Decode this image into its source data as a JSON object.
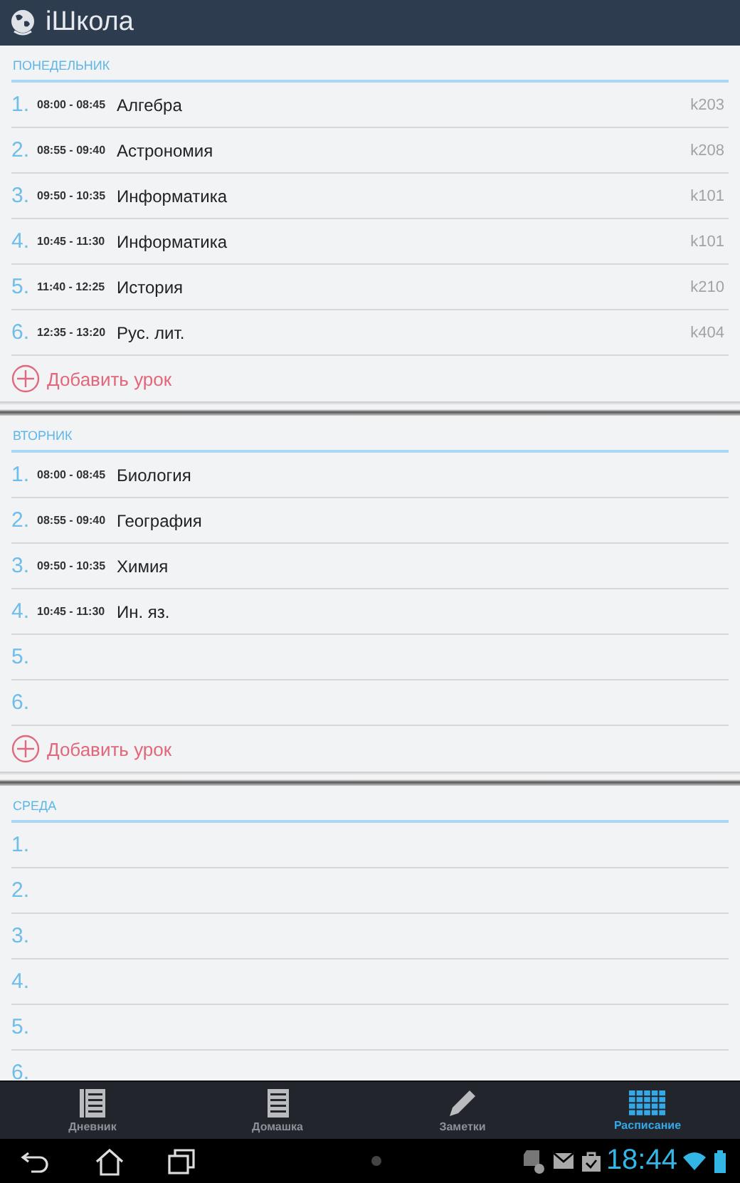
{
  "app_bar": {
    "title": "iШкола"
  },
  "days": [
    {
      "name": "ПОНЕДЕЛЬНИК",
      "lessons": [
        {
          "number": "1.",
          "time": "08:00 - 08:45",
          "subject": "Алгебра",
          "room": "k203"
        },
        {
          "number": "2.",
          "time": "08:55 - 09:40",
          "subject": "Астрономия",
          "room": "k208"
        },
        {
          "number": "3.",
          "time": "09:50 - 10:35",
          "subject": "Информатика",
          "room": "k101"
        },
        {
          "number": "4.",
          "time": "10:45 - 11:30",
          "subject": "Информатика",
          "room": "k101"
        },
        {
          "number": "5.",
          "time": "11:40 - 12:25",
          "subject": "История",
          "room": "k210"
        },
        {
          "number": "6.",
          "time": "12:35 - 13:20",
          "subject": "Рус. лит.",
          "room": "k404"
        }
      ],
      "add_label": "Добавить урок"
    },
    {
      "name": "ВТОРНИК",
      "lessons": [
        {
          "number": "1.",
          "time": "08:00 - 08:45",
          "subject": "Биология"
        },
        {
          "number": "2.",
          "time": "08:55 - 09:40",
          "subject": "География"
        },
        {
          "number": "3.",
          "time": "09:50 - 10:35",
          "subject": "Химия"
        },
        {
          "number": "4.",
          "time": "10:45 - 11:30",
          "subject": "Ин. яз."
        },
        {
          "number": "5."
        },
        {
          "number": "6."
        }
      ],
      "add_label": "Добавить урок"
    },
    {
      "name": "СРЕДА",
      "lessons": [
        {
          "number": "1."
        },
        {
          "number": "2."
        },
        {
          "number": "3."
        },
        {
          "number": "4."
        },
        {
          "number": "5."
        },
        {
          "number": "6."
        }
      ]
    }
  ],
  "nav": [
    {
      "kind": "diary",
      "label": "Дневник",
      "selected": false
    },
    {
      "kind": "homework",
      "label": "Домашка",
      "selected": false
    },
    {
      "kind": "notes",
      "label": "Заметки",
      "selected": false
    },
    {
      "kind": "schedule",
      "label": "Расписание",
      "selected": true
    }
  ],
  "status_bar": {
    "time": "18:44"
  }
}
